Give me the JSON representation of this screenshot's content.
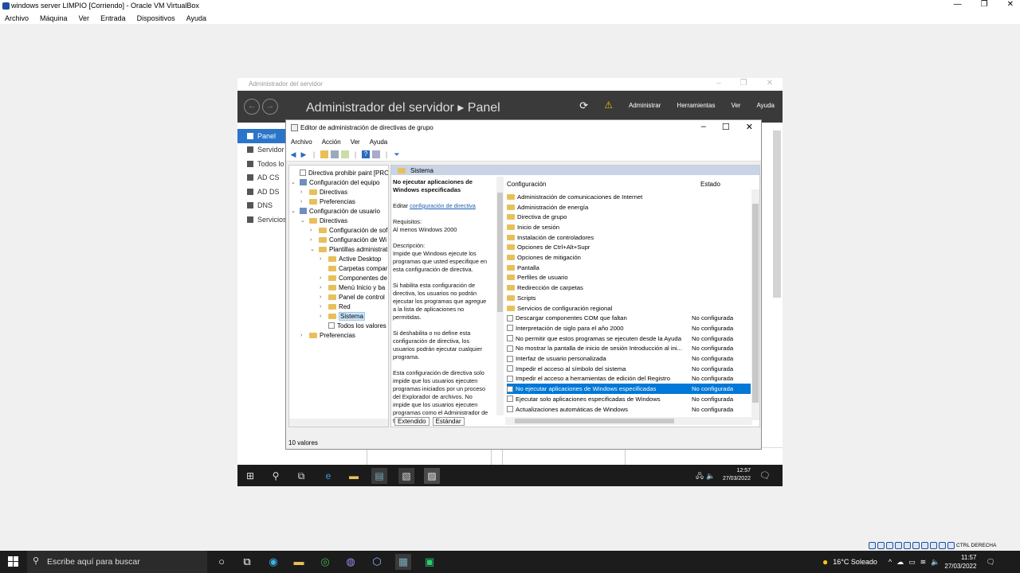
{
  "host_window": {
    "title": "windows server LIMPIO [Corriendo] - Oracle VM VirtualBox",
    "controls": [
      "—",
      "❐",
      "✕"
    ],
    "menu": [
      "Archivo",
      "Máquina",
      "Ver",
      "Entrada",
      "Dispositivos",
      "Ayuda"
    ]
  },
  "server_manager": {
    "window_title": "Administrador del servidor",
    "header_title": "Administrador del servidor ▸ Panel",
    "header_menu": [
      "Administrar",
      "Herramientas",
      "Ver",
      "Ayuda"
    ],
    "sidebar": [
      "Panel",
      "Servidor",
      "Todos lo",
      "AD CS",
      "AD DS",
      "DNS",
      "Servicios"
    ]
  },
  "gpe": {
    "title": "Editor de administración de directivas de grupo",
    "menu": [
      "Archivo",
      "Acción",
      "Ver",
      "Ayuda"
    ],
    "tree": [
      {
        "label": "Directiva prohibir paint [PRONG",
        "depth": 0,
        "arrow": "",
        "icon": "pol"
      },
      {
        "label": "Configuración del equipo",
        "depth": 0,
        "arrow": "⌄",
        "icon": "pc"
      },
      {
        "label": "Directivas",
        "depth": 1,
        "arrow": "›",
        "icon": "fd"
      },
      {
        "label": "Preferencias",
        "depth": 1,
        "arrow": "›",
        "icon": "fd"
      },
      {
        "label": "Configuración de usuario",
        "depth": 0,
        "arrow": "⌄",
        "icon": "pc"
      },
      {
        "label": "Directivas",
        "depth": 1,
        "arrow": "⌄",
        "icon": "fd"
      },
      {
        "label": "Configuración de sof",
        "depth": 2,
        "arrow": "›",
        "icon": "fd"
      },
      {
        "label": "Configuración de Wi",
        "depth": 2,
        "arrow": "›",
        "icon": "fd"
      },
      {
        "label": "Plantillas administrat",
        "depth": 2,
        "arrow": "⌄",
        "icon": "fd"
      },
      {
        "label": "Active Desktop",
        "depth": 3,
        "arrow": "›",
        "icon": "fd"
      },
      {
        "label": "Carpetas compar",
        "depth": 3,
        "arrow": "",
        "icon": "fd"
      },
      {
        "label": "Componentes de",
        "depth": 3,
        "arrow": "›",
        "icon": "fd"
      },
      {
        "label": "Menú Inicio y ba",
        "depth": 3,
        "arrow": "›",
        "icon": "fd"
      },
      {
        "label": "Panel de control",
        "depth": 3,
        "arrow": "›",
        "icon": "fd"
      },
      {
        "label": "Red",
        "depth": 3,
        "arrow": "›",
        "icon": "fd"
      },
      {
        "label": "Sistema",
        "depth": 3,
        "arrow": "›",
        "icon": "fd",
        "selected": true
      },
      {
        "label": "Todos los valores",
        "depth": 3,
        "arrow": "",
        "icon": "pol"
      },
      {
        "label": "Preferencias",
        "depth": 1,
        "arrow": "›",
        "icon": "fd"
      }
    ],
    "detail_header": "Sistema",
    "extended": {
      "policy_title": "No ejecutar aplicaciones de Windows especificadas",
      "edit_prefix": "Editar",
      "edit_link": "configuración de directiva",
      "req_label": "Requisitos:",
      "req_value": "Al menos Windows 2000",
      "desc_label": "Descripción:",
      "desc_1": "Impide que Windows ejecute los programas que usted especifique en esta configuración de directiva.",
      "desc_2": "Si habilita esta configuración de directiva, los usuarios no podrán ejecutar los programas que agregue a la lista de aplicaciones no permitidas.",
      "desc_3": "Si deshabilita o no define esta configuración de directiva, los usuarios podrán ejecutar cualquier programa.",
      "desc_4": "Esta configuración de directiva solo impide que los usuarios ejecuten programas iniciados por un proceso del Explorador de archivos. No impide que los usuarios ejecuten programas como el Administrador de tareas"
    },
    "columns": {
      "config": "Configuración",
      "state": "Estado"
    },
    "items": [
      {
        "name": "Administración de comunicaciones de Internet",
        "state": "",
        "icon": "fd"
      },
      {
        "name": "Administración de energía",
        "state": "",
        "icon": "fd"
      },
      {
        "name": "Directiva de grupo",
        "state": "",
        "icon": "fd"
      },
      {
        "name": "Inicio de sesión",
        "state": "",
        "icon": "fd"
      },
      {
        "name": "Instalación de controladores",
        "state": "",
        "icon": "fd"
      },
      {
        "name": "Opciones de Ctrl+Alt+Supr",
        "state": "",
        "icon": "fd"
      },
      {
        "name": "Opciones de mitigación",
        "state": "",
        "icon": "fd"
      },
      {
        "name": "Pantalla",
        "state": "",
        "icon": "fd"
      },
      {
        "name": "Perfiles de usuario",
        "state": "",
        "icon": "fd"
      },
      {
        "name": "Redirección de carpetas",
        "state": "",
        "icon": "fd"
      },
      {
        "name": "Scripts",
        "state": "",
        "icon": "fd"
      },
      {
        "name": "Servicios de configuración regional",
        "state": "",
        "icon": "fd"
      },
      {
        "name": "Descargar componentes COM que faltan",
        "state": "No configurada",
        "icon": "pol"
      },
      {
        "name": "Interpretación de siglo para el año 2000",
        "state": "No configurada",
        "icon": "pol"
      },
      {
        "name": "No permitir que estos programas se ejecuten desde la Ayuda",
        "state": "No configurada",
        "icon": "pol"
      },
      {
        "name": "No mostrar la pantalla de inicio de sesión Introducción al ini...",
        "state": "No configurada",
        "icon": "pol"
      },
      {
        "name": "Interfaz de usuario personalizada",
        "state": "No configurada",
        "icon": "pol"
      },
      {
        "name": "Impedir el acceso al símbolo del sistema",
        "state": "No configurada",
        "icon": "pol"
      },
      {
        "name": "Impedir el acceso a herramientas de edición del Registro",
        "state": "No configurada",
        "icon": "pol"
      },
      {
        "name": "No ejecutar aplicaciones de Windows especificadas",
        "state": "No configurada",
        "icon": "pol",
        "selected": true
      },
      {
        "name": "Ejecutar solo aplicaciones especificadas de Windows",
        "state": "No configurada",
        "icon": "pol"
      },
      {
        "name": "Actualizaciones automáticas de Windows",
        "state": "No configurada",
        "icon": "pol"
      }
    ],
    "tabs": [
      "Extendido",
      "Estándar"
    ],
    "status": "10 valores"
  },
  "vm_clock": {
    "time": "12:57",
    "date": "27/03/2022"
  },
  "host_tray": {
    "label": "CTRL DERECHA"
  },
  "host_taskbar": {
    "search_placeholder": "Escribe aquí para buscar",
    "weather": "16°C Soleado",
    "time": "11:57",
    "date": "27/03/2022"
  },
  "colors": {
    "selection": "#0078d7",
    "header_dark": "#3a3a3a",
    "taskbar": "#1c1c1c"
  }
}
